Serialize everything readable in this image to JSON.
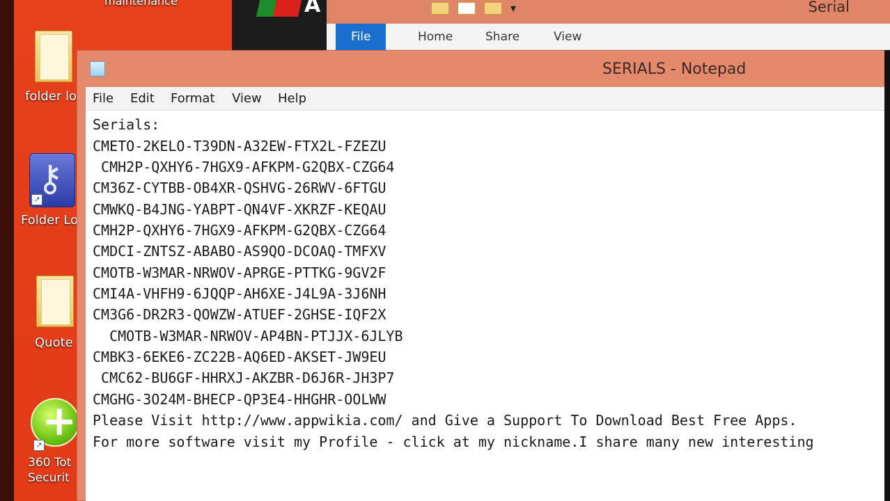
{
  "desktop": {
    "top_label": "maintenance",
    "icons": [
      {
        "name": "folder-lock-icon",
        "label": "folder lo"
      },
      {
        "name": "folder-lock-shortcut-icon",
        "label": "Folder Lo"
      },
      {
        "name": "quote-folder-icon",
        "label": "Quote"
      },
      {
        "name": "360-total-security-icon",
        "label_line1": "360 Tot",
        "label_line2": "Securit"
      }
    ]
  },
  "explorer": {
    "title": "Serial",
    "tabs": [
      "File",
      "Home",
      "Share",
      "View"
    ],
    "logo_letter": "A",
    "qat_arrow": "▾"
  },
  "notepad": {
    "title": "SERIALS - Notepad",
    "menu": [
      "File",
      "Edit",
      "Format",
      "View",
      "Help"
    ],
    "lines": [
      "Serials:",
      "CMETO-2KELO-T39DN-A32EW-FTX2L-FZEZU",
      " CMH2P-QXHY6-7HGX9-AFKPM-G2QBX-CZG64",
      "CM36Z-CYTBB-OB4XR-QSHVG-26RWV-6FTGU",
      "CMWKQ-B4JNG-YABPT-QN4VF-XKRZF-KEQAU",
      "CMH2P-QXHY6-7HGX9-AFKPM-G2QBX-CZG64",
      "CMDCI-ZNTSZ-ABABO-AS9QO-DCOAQ-TMFXV",
      "CMOTB-W3MAR-NRWOV-APRGE-PTTKG-9GV2F",
      "CMI4A-VHFH9-6JQQP-AH6XE-J4L9A-3J6NH",
      "CM3G6-DR2R3-QOWZW-ATUEF-2GHSE-IQF2X",
      "  CMOTB-W3MAR-NRWOV-AP4BN-PTJJX-6JLYB",
      "CMBK3-6EKE6-ZC22B-AQ6ED-AKSET-JW9EU",
      " CMC62-BU6GF-HHRXJ-AKZBR-D6J6R-JH3P7",
      "CMGHG-3O24M-BHECP-QP3E4-HHGHR-OOLWW",
      "Please Visit http://www.appwikia.com/ and Give a Support To Download Best Free Apps.",
      "For more software visit my Profile - click at my nickname.I share many new interesting"
    ],
    "selected_line_index": 1
  }
}
